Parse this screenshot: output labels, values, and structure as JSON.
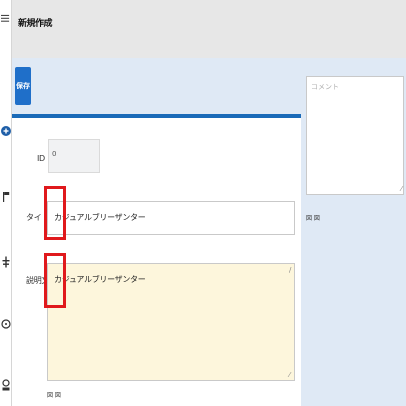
{
  "header": {
    "title": "新規作成"
  },
  "sidebar": {
    "icons": [
      "menu-icon",
      "plus-circle-icon",
      "flag-icon",
      "settings-icon",
      "help-icon",
      "user-icon"
    ]
  },
  "toolbar": {
    "save_label": "保存"
  },
  "form": {
    "id_label": "ID",
    "id_value": "0",
    "title_label": "タイトル",
    "title_value": "カジュアルブリーザンター",
    "desc_label": "説明文",
    "desc_value": "カジュアルブリーザンター",
    "footer_label": "図 図"
  },
  "comment": {
    "placeholder": "コメント",
    "footer_label": "図 図"
  },
  "colors": {
    "accent": "#1f6fc9",
    "header_bg": "#e7e7e7",
    "panel_bg": "#dfe9f5",
    "highlight": "#e0191c",
    "desc_bg": "#fdf6dc"
  }
}
